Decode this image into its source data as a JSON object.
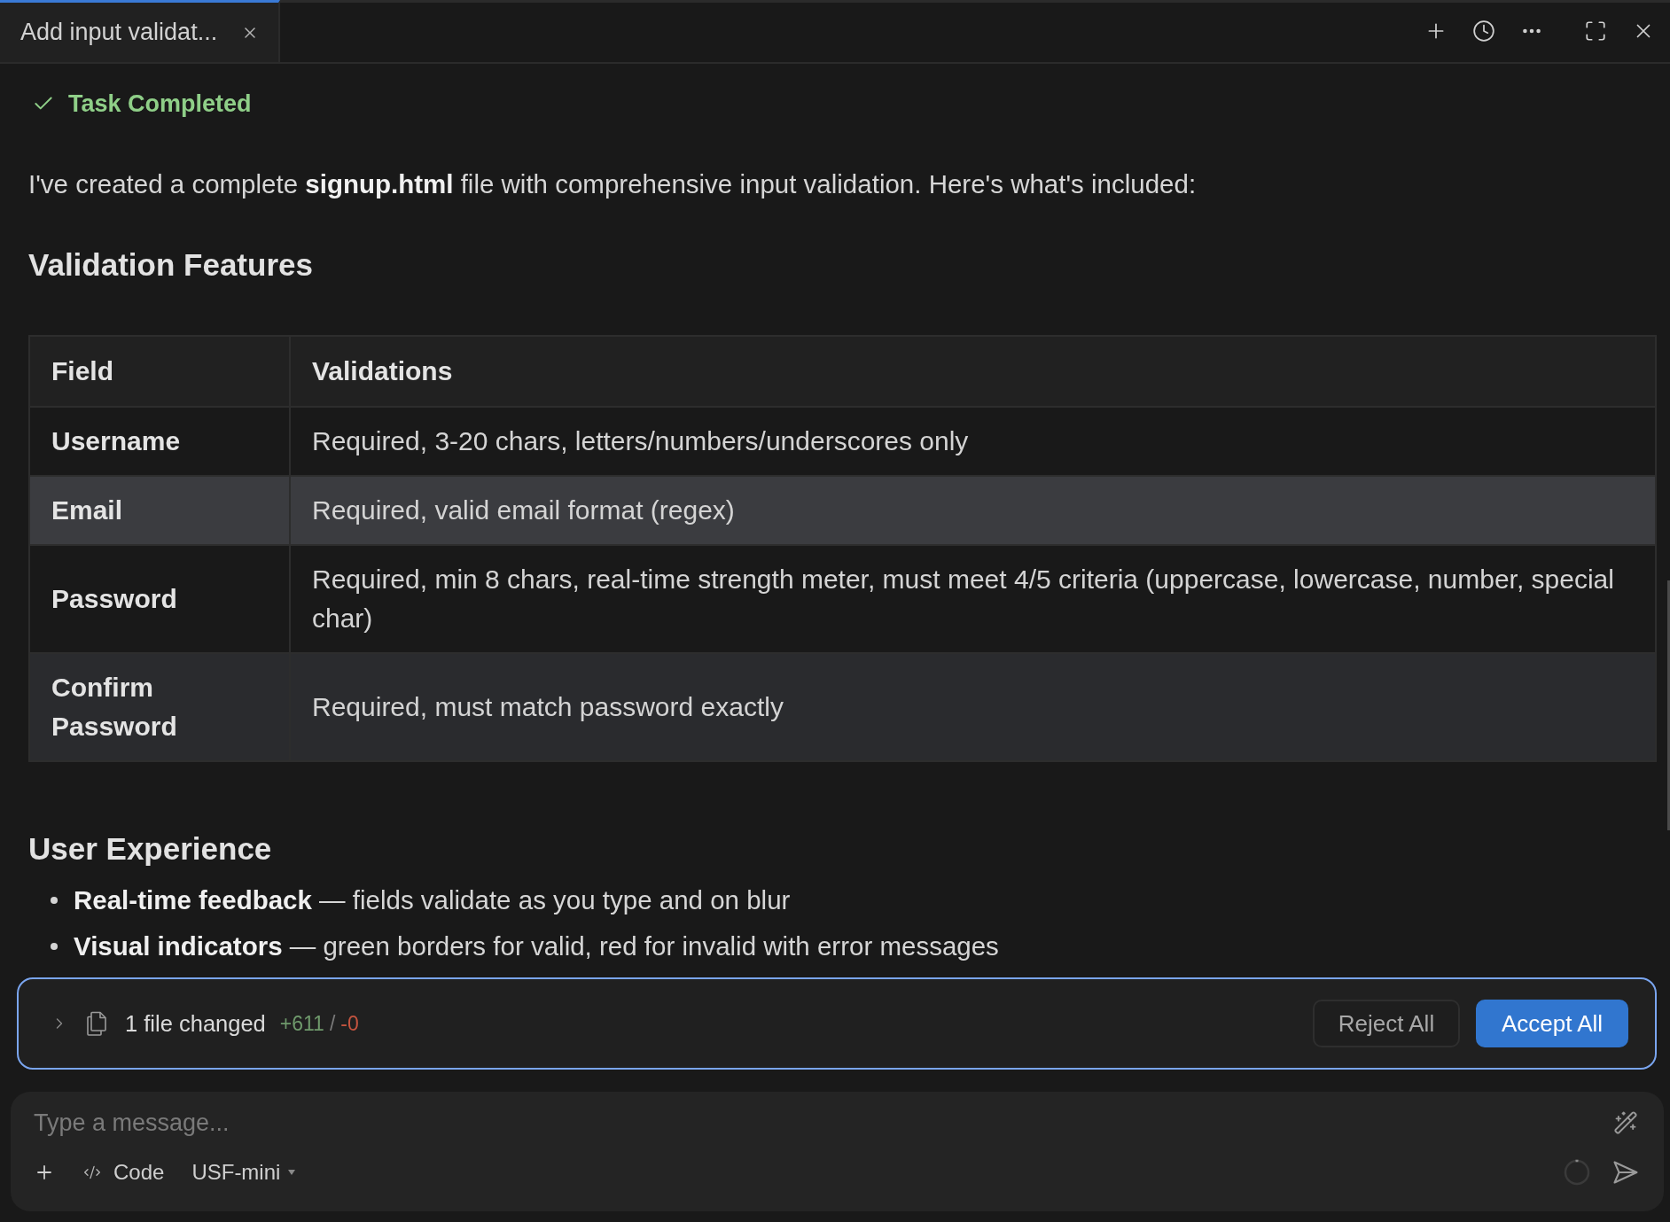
{
  "tabs": [
    {
      "label": "Add input validat...",
      "selected": true
    }
  ],
  "status": "Task Completed",
  "intro": "I've created a complete **signup.html** file with comprehensive input validation. Here's what's included:",
  "sections": [
    {
      "kind": "table",
      "heading": "Validation Features",
      "columns": [
        "Field",
        "Validations"
      ],
      "rows": [
        {
          "cells": [
            "Username",
            "Required, 3-20 chars, letters/numbers/underscores only"
          ],
          "hovered": false
        },
        {
          "cells": [
            "Email",
            "Required, valid email format (regex)"
          ],
          "hovered": true
        },
        {
          "cells": [
            "Password",
            "Required, min 8 chars, real-time strength meter, must meet 4/5 criteria (uppercase, lowercase, number, special char)"
          ],
          "hovered": false
        },
        {
          "cells": [
            "Confirm Password",
            "Required, must match password exactly"
          ],
          "hovered": false
        }
      ]
    },
    {
      "kind": "list",
      "heading": "User Experience",
      "items": [
        "**Real-time feedback** — fields validate as you type and on blur",
        "**Visual indicators** — green borders for valid, red for invalid with error messages"
      ]
    }
  ],
  "changes": {
    "expanded": false,
    "summary": "1 file changed",
    "added": "+611",
    "separator": "/",
    "removed": "-0",
    "buttons": [
      {
        "label": "Reject All",
        "kind": "secondary"
      },
      {
        "label": "Accept All",
        "kind": "primary"
      }
    ]
  },
  "composer": {
    "placeholder": "Type a message...",
    "mode": "Code",
    "model": "USF-mini"
  }
}
